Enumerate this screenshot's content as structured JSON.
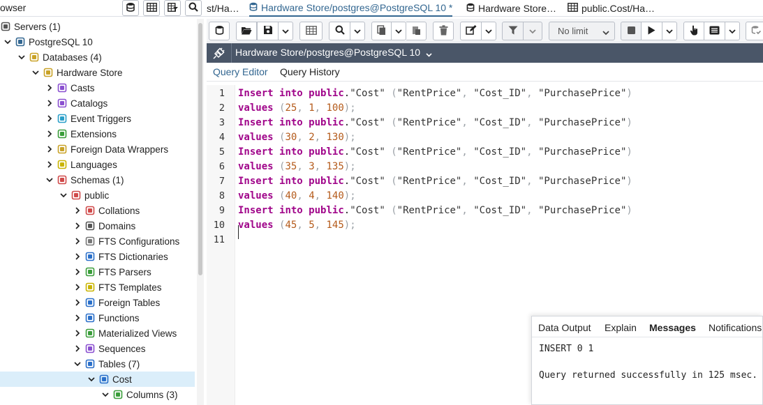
{
  "browser_title": "owser",
  "top_icons": [
    "database-icon",
    "table-grid-icon",
    "table-filter-icon",
    "search-icon"
  ],
  "tabs": [
    {
      "label": "st/Ha…",
      "icon": "none"
    },
    {
      "label": "Hardware Store/postgres@PostgreSQL 10 *",
      "icon": "database-icon",
      "active": true
    },
    {
      "label": "Hardware Store…",
      "icon": "database-icon"
    },
    {
      "label": "public.Cost/Ha…",
      "icon": "table-icon"
    }
  ],
  "tree": [
    {
      "label": "Servers (1)",
      "icon": "servers-icon",
      "expanded": true
    },
    {
      "label": "PostgreSQL 10",
      "icon": "elephant-icon",
      "expanded": true
    },
    {
      "label": "Databases (4)",
      "icon": "databases-icon",
      "expanded": true
    },
    {
      "label": "Hardware Store",
      "icon": "database-icon",
      "expanded": true
    },
    {
      "label": "Casts",
      "icon": "casts-icon",
      "expanded": false
    },
    {
      "label": "Catalogs",
      "icon": "catalogs-icon",
      "expanded": false
    },
    {
      "label": "Event Triggers",
      "icon": "event-trigger-icon",
      "expanded": false
    },
    {
      "label": "Extensions",
      "icon": "extension-icon",
      "expanded": false
    },
    {
      "label": "Foreign Data Wrappers",
      "icon": "fdw-icon",
      "expanded": false
    },
    {
      "label": "Languages",
      "icon": "language-icon",
      "expanded": false
    },
    {
      "label": "Schemas (1)",
      "icon": "schemas-icon",
      "expanded": true
    },
    {
      "label": "public",
      "icon": "schema-icon",
      "expanded": true
    },
    {
      "label": "Collations",
      "icon": "collation-icon",
      "expanded": false
    },
    {
      "label": "Domains",
      "icon": "domain-icon",
      "expanded": false
    },
    {
      "label": "FTS Configurations",
      "icon": "fts-config-icon",
      "expanded": false
    },
    {
      "label": "FTS Dictionaries",
      "icon": "fts-dictionary-icon",
      "expanded": false
    },
    {
      "label": "FTS Parsers",
      "icon": "fts-parser-icon",
      "expanded": false
    },
    {
      "label": "FTS Templates",
      "icon": "fts-template-icon",
      "expanded": false
    },
    {
      "label": "Foreign Tables",
      "icon": "foreign-table-icon",
      "expanded": false
    },
    {
      "label": "Functions",
      "icon": "function-icon",
      "expanded": false
    },
    {
      "label": "Materialized Views",
      "icon": "mview-icon",
      "expanded": false
    },
    {
      "label": "Sequences",
      "icon": "sequence-icon",
      "expanded": false
    },
    {
      "label": "Tables (7)",
      "icon": "tables-icon",
      "expanded": true
    },
    {
      "label": "Cost",
      "icon": "table-icon",
      "expanded": true,
      "selected": true
    },
    {
      "label": "Columns (3)",
      "icon": "columns-icon",
      "expanded": true
    }
  ],
  "toolbar": {
    "limit_label": "No limit"
  },
  "connection": {
    "label": "Hardware Store/postgres@PostgreSQL 10"
  },
  "query_tabs": [
    "Query Editor",
    "Query History"
  ],
  "editor": {
    "lines": [
      "Insert into public.\"Cost\" (\"RentPrice\", \"Cost_ID\", \"PurchasePrice\")",
      "values (25, 1, 100);",
      "Insert into public.\"Cost\" (\"RentPrice\", \"Cost_ID\", \"PurchasePrice\")",
      "values (30, 2, 130);",
      "Insert into public.\"Cost\" (\"RentPrice\", \"Cost_ID\", \"PurchasePrice\")",
      "values (35, 3, 135);",
      "Insert into public.\"Cost\" (\"RentPrice\", \"Cost_ID\", \"PurchasePrice\")",
      "values (40, 4, 140);",
      "Insert into public.\"Cost\" (\"RentPrice\", \"Cost_ID\", \"PurchasePrice\")",
      "values (45, 5, 145);",
      ""
    ]
  },
  "messages": {
    "tabs": [
      "Data Output",
      "Explain",
      "Messages",
      "Notifications"
    ],
    "active_tab": "Messages",
    "lines": [
      "INSERT 0 1",
      "Query returned successfully in 125 msec."
    ]
  },
  "colors": {
    "accent": "#326690",
    "keyword": "#a0058a",
    "number": "#b45a1a",
    "connbar": "#4a5668",
    "selected_row": "#dbeefa"
  }
}
